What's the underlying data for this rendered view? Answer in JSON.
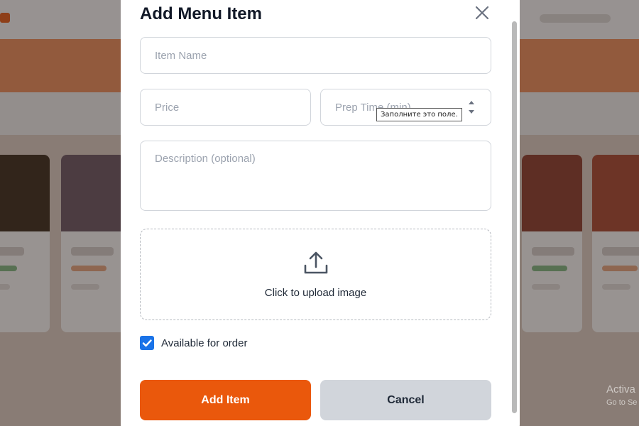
{
  "modal": {
    "title": "Add Menu Item",
    "fields": {
      "item_name_placeholder": "Item Name",
      "price_placeholder": "Price",
      "prep_time_placeholder": "Prep Time (min)",
      "description_placeholder": "Description (optional)"
    },
    "validation_tooltip": "Заполните это поле.",
    "upload": {
      "label": "Click to upload image",
      "icon": "upload-icon"
    },
    "available": {
      "label": "Available for order",
      "checked": true
    },
    "buttons": {
      "add": "Add Item",
      "cancel": "Cancel"
    },
    "accent_color": "#ea580c"
  },
  "os_watermark": {
    "line1": "Activa",
    "line2": "Go to Se"
  }
}
